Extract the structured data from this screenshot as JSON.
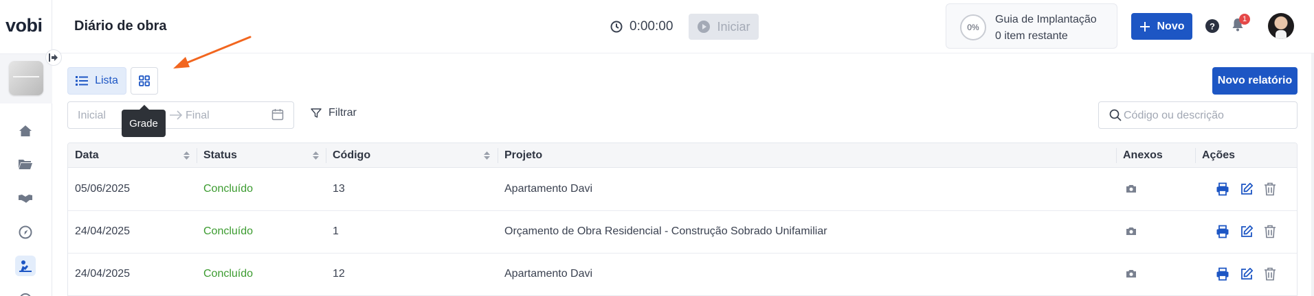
{
  "app": {
    "logo_text": "vobi",
    "page_title": "Diário de obra"
  },
  "header": {
    "timer": "0:00:00",
    "start_label": "Iniciar",
    "guide": {
      "percent": "0%",
      "title": "Guia de Implantação",
      "subtitle": "0 item restante"
    },
    "new_label": "Novo",
    "help_label": "?",
    "notifications_count": "1"
  },
  "toolbar": {
    "list_label": "Lista",
    "grid_tooltip": "Grade",
    "new_report_label": "Novo relatório",
    "date_start_placeholder": "Inicial",
    "date_end_placeholder": "Final",
    "filter_label": "Filtrar",
    "search_placeholder": "Código ou descrição"
  },
  "table": {
    "columns": [
      "Data",
      "Status",
      "Código",
      "Projeto",
      "Anexos",
      "Ações"
    ],
    "rows": [
      {
        "date": "05/06/2025",
        "status": "Concluído",
        "code": "13",
        "project": "Apartamento Davi"
      },
      {
        "date": "24/04/2025",
        "status": "Concluído",
        "code": "1",
        "project": "Orçamento de Obra Residencial - Construção Sobrado Unifamiliar"
      },
      {
        "date": "24/04/2025",
        "status": "Concluído",
        "code": "12",
        "project": "Apartamento Davi"
      }
    ]
  },
  "colors": {
    "primary": "#1d56c4",
    "status_done": "#3b9b2f",
    "badge": "#e54848",
    "annotation_arrow": "#f2661f"
  },
  "icons": {
    "sidebar": [
      "home-icon",
      "folder-icon",
      "handshake-icon",
      "compass-icon",
      "worker-icon"
    ],
    "row_actions": [
      "printer-icon",
      "edit-icon",
      "trash-icon"
    ],
    "attachments": "camera-icon"
  }
}
